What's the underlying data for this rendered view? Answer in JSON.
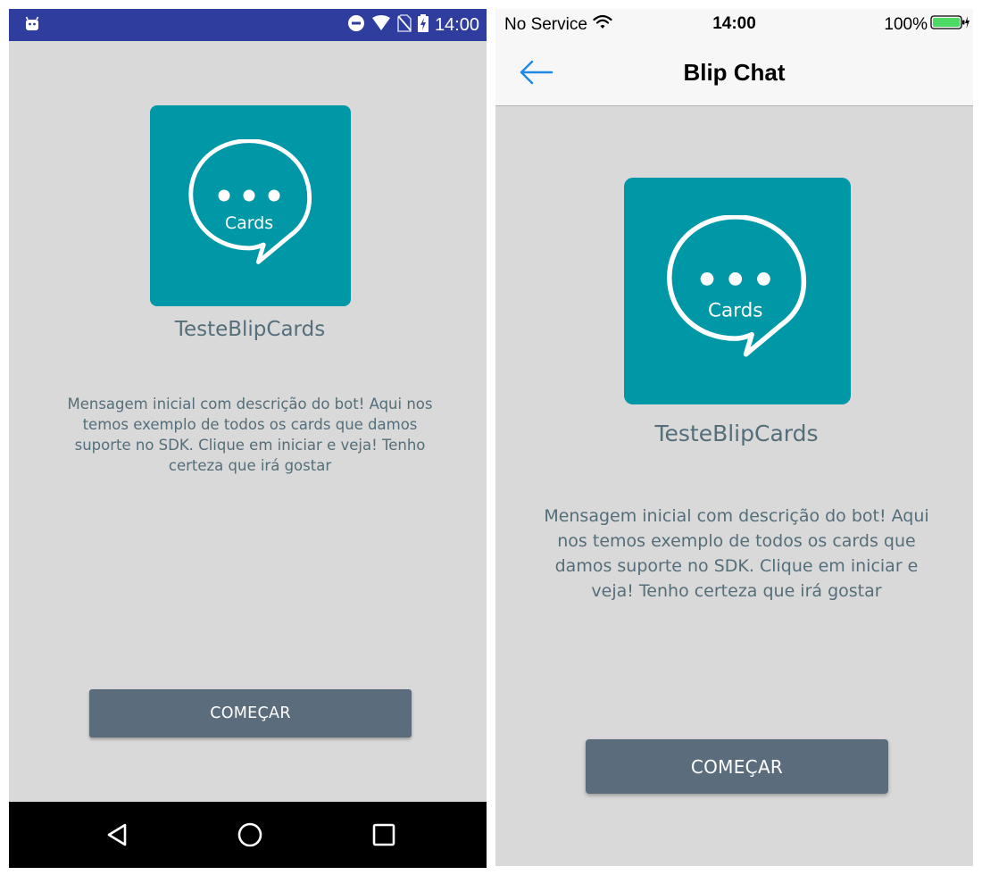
{
  "android": {
    "status_bar": {
      "time": "14:00"
    },
    "bot": {
      "name": "TesteBlipCards",
      "logo_text": "Cards",
      "description": "Mensagem inicial com descrição do bot! Aqui nos temos exemplo de todos os cards que damos suporte no SDK. Clique em iniciar e veja! Tenho certeza que irá gostar"
    },
    "start_button_label": "COMEÇAR",
    "nav_icons": [
      "back-icon",
      "home-icon",
      "recents-icon"
    ]
  },
  "ios": {
    "status_bar": {
      "carrier": "No Service",
      "time": "14:00",
      "battery": "100%"
    },
    "nav_bar": {
      "title": "Blip Chat"
    },
    "bot": {
      "name": "TesteBlipCards",
      "logo_text": "Cards",
      "description": "Mensagem inicial com descrição do bot! Aqui nos temos exemplo de todos os cards que damos suporte no SDK. Clique em iniciar e veja! Tenho certeza que irá gostar"
    },
    "start_button_label": "COMEÇAR"
  },
  "colors": {
    "logo_bg": "#0097a7",
    "button_bg": "#5b6d7c",
    "text": "#546e7a",
    "screen_bg": "#d9d9d9",
    "android_status_bg": "#2f3e9e",
    "ios_accent": "#1e88e5"
  }
}
